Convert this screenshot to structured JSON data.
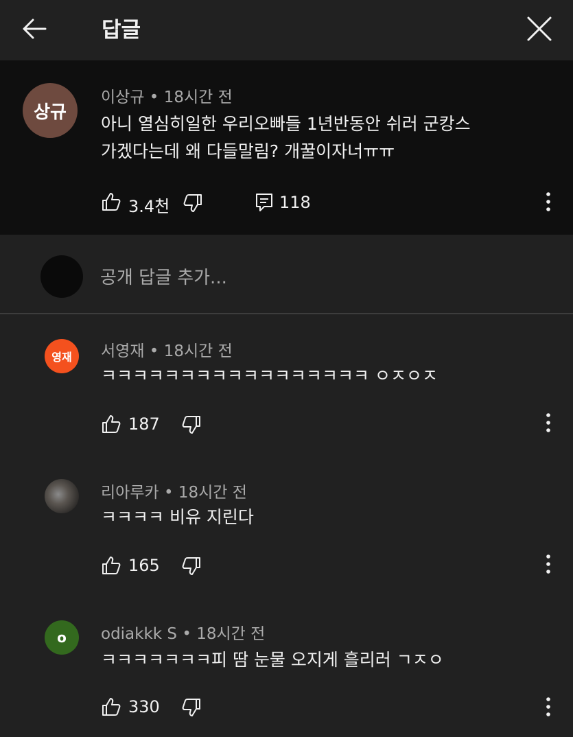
{
  "header": {
    "title": "답글",
    "back_icon": "arrow-left-icon",
    "close_icon": "close-icon"
  },
  "parent_comment": {
    "avatar_text": "상규",
    "avatar_color": "#6e4a3f",
    "author": "이상규",
    "time": "18시간 전",
    "text_line1": "아니 열심히일한 우리오빠들 1년반동안 쉬러 군캉스",
    "text_line2": "가겠다는데 왜 다들말림? 개꿀이자너ㅠㅠ",
    "likes": "3.4천",
    "reply_count": "118"
  },
  "reply_box": {
    "placeholder": "공개 답글 추가..."
  },
  "replies": [
    {
      "avatar_text": "영재",
      "avatar_color": "#f4511e",
      "author": "서영재",
      "time": "18시간 전",
      "text": "ㅋㅋㅋㅋㅋㅋㅋㅋㅋㅋㅋㅋㅋㅋㅋㅋㅋ ㅇㅈㅇㅈ",
      "likes": "187"
    },
    {
      "avatar_text": "",
      "avatar_color": "#4a4a4a",
      "author": "리아루카",
      "time": "18시간 전",
      "text": "ㅋㅋㅋㅋ 비유 지린다",
      "likes": "165"
    },
    {
      "avatar_text": "o",
      "avatar_color": "#33691e",
      "author": "odiakkk S",
      "time": "18시간 전",
      "text": "ㅋㅋㅋㅋㅋㅋㅋ피 땀 눈물 오지게 흘리러 ㄱㅈㅇ",
      "likes": "330"
    }
  ],
  "separator": "•"
}
